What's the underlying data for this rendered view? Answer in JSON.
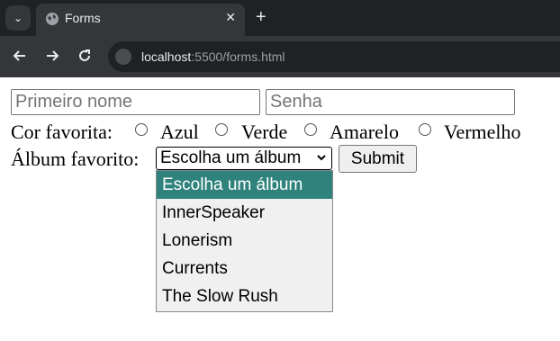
{
  "browser": {
    "tab_title": "Forms",
    "tab_close": "✕",
    "new_tab": "+",
    "menu_glyph": "⌄",
    "url_host": "localhost",
    "url_rest": ":5500/forms.html"
  },
  "form": {
    "first_name_placeholder": "Primeiro nome",
    "password_placeholder": "Senha",
    "color_label": "Cor favorita:",
    "colors": [
      "Azul",
      "Verde",
      "Amarelo",
      "Vermelho"
    ],
    "album_label": "Álbum favorito:",
    "album_selected": "Escolha um álbum",
    "album_options": [
      "Escolha um álbum",
      "InnerSpeaker",
      "Lonerism",
      "Currents",
      "The Slow Rush"
    ],
    "submit_label": "Submit"
  }
}
